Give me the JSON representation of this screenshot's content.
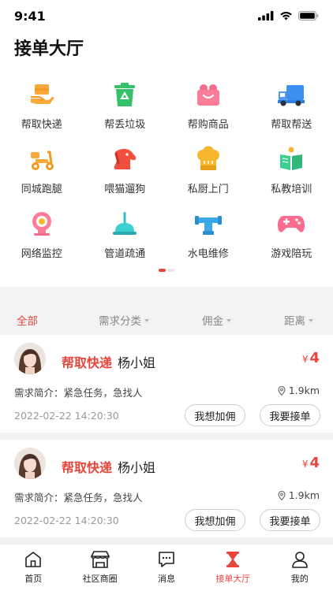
{
  "status_bar": {
    "time": "9:41"
  },
  "page": {
    "title": "接单大厅"
  },
  "services": [
    {
      "label": "帮取快递",
      "icon": "parcel-hand-icon"
    },
    {
      "label": "帮丢垃圾",
      "icon": "recycle-bin-icon"
    },
    {
      "label": "帮购商品",
      "icon": "shopping-bag-icon"
    },
    {
      "label": "帮取帮送",
      "icon": "delivery-truck-icon"
    },
    {
      "label": "同城跑腿",
      "icon": "scooter-icon"
    },
    {
      "label": "喂猫遛狗",
      "icon": "dog-icon"
    },
    {
      "label": "私厨上门",
      "icon": "chef-hat-icon"
    },
    {
      "label": "私教培训",
      "icon": "open-book-icon"
    },
    {
      "label": "网络监控",
      "icon": "webcam-icon"
    },
    {
      "label": "管道疏通",
      "icon": "plunger-icon"
    },
    {
      "label": "水电维修",
      "icon": "pipe-wrench-icon"
    },
    {
      "label": "游戏陪玩",
      "icon": "gamepad-icon"
    }
  ],
  "filters": {
    "all": "全部",
    "category": "需求分类",
    "commission": "佣金",
    "distance": "距离"
  },
  "orders": [
    {
      "service": "帮取快递",
      "name": "杨小姐",
      "currency": "¥",
      "price": "4",
      "desc": "需求简介：紧急任务，急找人",
      "distance": "1.9km",
      "date": "2022-02-22 14:20:30",
      "raise_label": "我想加佣",
      "take_label": "我要接单"
    },
    {
      "service": "帮取快递",
      "name": "杨小姐",
      "currency": "¥",
      "price": "4",
      "desc": "需求简介：紧急任务，急找人",
      "distance": "1.9km",
      "date": "2022-02-22 14:20:30",
      "raise_label": "我想加佣",
      "take_label": "我要接单"
    }
  ],
  "tabbar": [
    {
      "label": "首页",
      "icon": "home-icon"
    },
    {
      "label": "社区商圈",
      "icon": "storefront-icon"
    },
    {
      "label": "消息",
      "icon": "message-icon"
    },
    {
      "label": "接单大厅",
      "icon": "hourglass-icon"
    },
    {
      "label": "我的",
      "icon": "user-icon"
    }
  ],
  "colors": {
    "accent": "#e8453c",
    "text": "#333333",
    "muted": "#999999",
    "background": "#f3f3f3"
  }
}
